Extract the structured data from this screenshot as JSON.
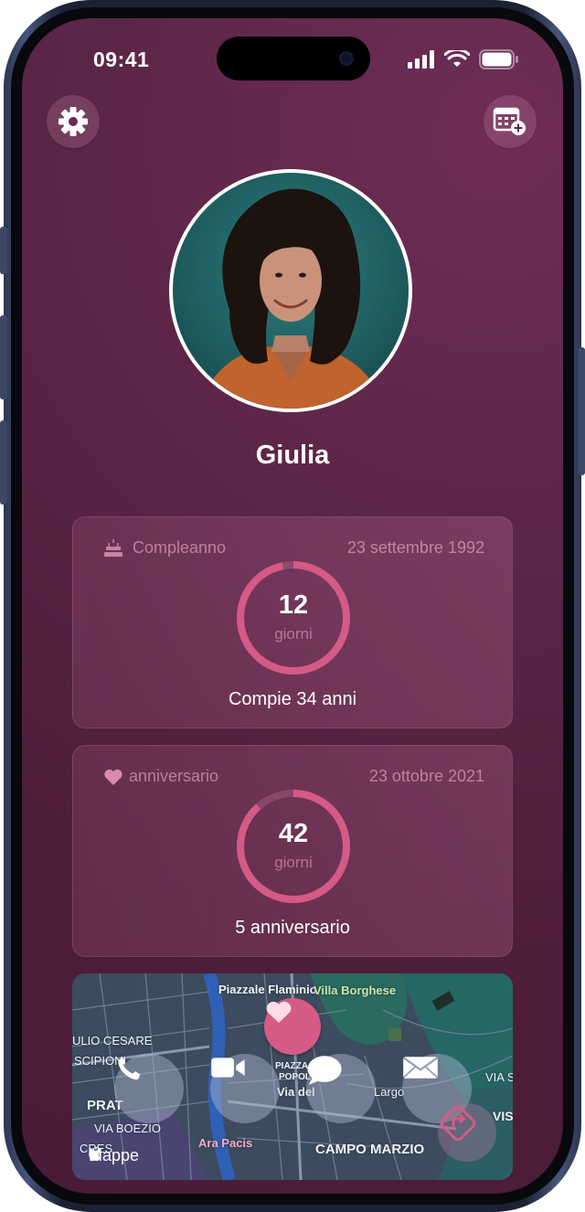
{
  "status_bar": {
    "time": "09:41"
  },
  "header": {
    "settings_icon": "gear-icon",
    "add_event_icon": "calendar-add-icon"
  },
  "profile": {
    "name": "Giulia"
  },
  "cards": [
    {
      "icon": "cake-icon",
      "label": "Compleanno",
      "date": "23 settembre 1992",
      "days_number": "12",
      "days_unit": "giorni",
      "footer": "Compie 34 anni",
      "progress": 0.967
    },
    {
      "icon": "heart-icon",
      "label": "anniversario",
      "date": "23 ottobre 2021",
      "days_number": "42",
      "days_unit": "giorni",
      "footer": "5 anniversario",
      "progress": 0.885
    }
  ],
  "map": {
    "labels": {
      "piazzale_flaminio": "Piazzale Flaminio",
      "villa_borghese": "Villa Borghese",
      "giulio_cesare": "ULIO CESARE",
      "scipioni": "SCIPIONI",
      "prati": "PRAT",
      "via_boezio": "VIA BOEZIO",
      "cres": "CRES",
      "ara_pacis": "Ara Pacis",
      "campo_marzio": "CAMPO MARZIO",
      "via_sa": "VIA SA",
      "vis": "VIS",
      "piazza_del": "PIAZZA DEL",
      "popolo": "POPOLO",
      "via_del": "Via del",
      "largo": "Largo"
    },
    "brand": "Mappe",
    "actions": [
      "phone-icon",
      "video-icon",
      "message-icon",
      "mail-icon"
    ],
    "pin_icon": "heart-icon",
    "directions_icon": "directions-icon"
  },
  "colors": {
    "accent": "#d55a86",
    "background": "#4f1d3c"
  }
}
